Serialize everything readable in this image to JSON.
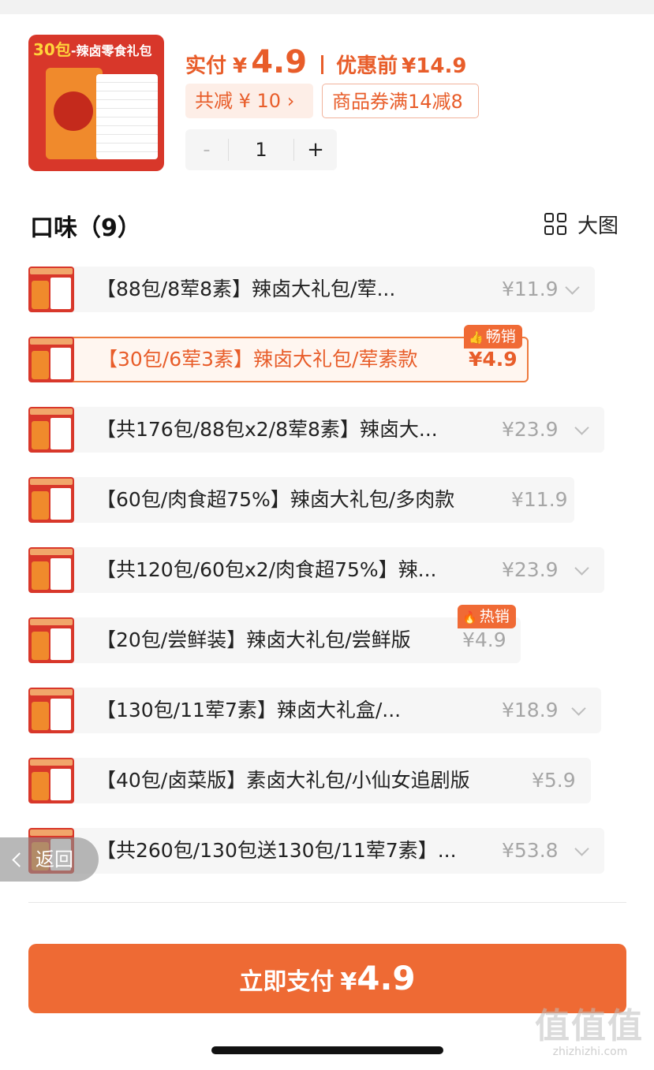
{
  "product": {
    "image_banner_num": "30包",
    "image_banner_text": "-辣卤零食礼包",
    "pay_label": "实付",
    "yen": "¥",
    "pay_amount": "4.9",
    "original_label": "优惠前",
    "original_price": "¥14.9",
    "discount_chip": "共减 ¥ 10 ›",
    "coupon_chip": "商品券满14减8",
    "quantity": "1",
    "minus": "-",
    "plus": "+"
  },
  "section": {
    "title": "口味（9）",
    "view_toggle_label": "大图",
    "view_toggle_icon": "grid-icon"
  },
  "options": [
    {
      "label": "【88包/8荤8素】辣卤大礼包/荤...",
      "price": "¥11.9",
      "chevron": true,
      "selected": false,
      "badge": null
    },
    {
      "label": "【30包/6荤3素】辣卤大礼包/荤素款",
      "price": "¥4.9",
      "chevron": false,
      "selected": true,
      "badge": {
        "icon": "thumbs-up-icon",
        "glyph": "👍",
        "text": "畅销"
      }
    },
    {
      "label": "【共176包/88包x2/8荤8素】辣卤大...",
      "price": "¥23.9",
      "chevron": true,
      "selected": false,
      "badge": null
    },
    {
      "label": "【60包/肉食超75%】辣卤大礼包/多肉款",
      "price": "¥11.9",
      "chevron": false,
      "selected": false,
      "badge": null
    },
    {
      "label": "【共120包/60包x2/肉食超75%】辣...",
      "price": "¥23.9",
      "chevron": true,
      "selected": false,
      "badge": null
    },
    {
      "label": "【20包/尝鲜装】辣卤大礼包/尝鲜版",
      "price": "¥4.9",
      "chevron": false,
      "selected": false,
      "badge": {
        "icon": "flame-icon",
        "glyph": "🔥",
        "text": "热销"
      }
    },
    {
      "label": "【130包/11荤7素】辣卤大礼盒/...",
      "price": "¥18.9",
      "chevron": true,
      "selected": false,
      "badge": null
    },
    {
      "label": "【40包/卤菜版】素卤大礼包/小仙女追剧版",
      "price": "¥5.9",
      "chevron": false,
      "selected": false,
      "badge": null
    },
    {
      "label": "【共260包/130包送130包/11荤7素】...",
      "price": "¥53.8",
      "chevron": true,
      "selected": false,
      "badge": null
    }
  ],
  "back_button": {
    "label": "返回"
  },
  "pay_button": {
    "label": "立即支付",
    "yen": "¥",
    "amount": "4.9"
  },
  "watermark": {
    "mark": "值值值",
    "url": "zhizhizhi.com"
  },
  "colors": {
    "accent": "#ee6a34",
    "accent_text": "#e85d2a",
    "thumb_red": "#d8372a"
  }
}
